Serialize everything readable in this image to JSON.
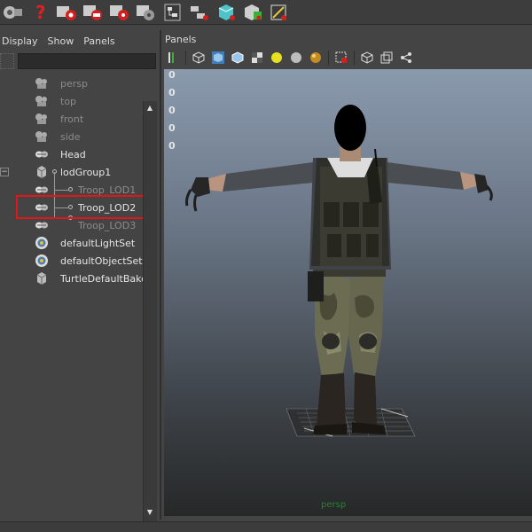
{
  "shelf": {
    "icons": [
      "render-camera-icon",
      "help-icon",
      "render-settings-icon",
      "ipr-render-icon",
      "render-view-icon",
      "render-globals-icon",
      "hypershade-icon",
      "sep",
      "connection-editor-icon",
      "attribute-spreadsheet-icon",
      "cube-select-icon",
      "layer-editor-icon"
    ]
  },
  "outliner": {
    "menu": {
      "display": "Display",
      "show": "Show",
      "panels": "Panels"
    },
    "search_value": "",
    "items": [
      {
        "label": "persp",
        "state": "dim"
      },
      {
        "label": "top",
        "state": "dim"
      },
      {
        "label": "front",
        "state": "dim"
      },
      {
        "label": "side",
        "state": "dim"
      },
      {
        "label": "Head",
        "state": "bright"
      },
      {
        "label": "lodGroup1",
        "state": "bright"
      },
      {
        "label": "Troop_LOD1",
        "state": "dim"
      },
      {
        "label": "Troop_LOD2",
        "state": "bright"
      },
      {
        "label": "Troop_LOD3",
        "state": "dim"
      },
      {
        "label": "defaultLightSet",
        "state": "bright"
      },
      {
        "label": "defaultObjectSet",
        "state": "bright"
      },
      {
        "label": "TurtleDefaultBakeLa",
        "state": "bright"
      }
    ],
    "collapse_glyph": "−",
    "selected_item": "Troop_LOD2"
  },
  "viewport": {
    "menu": {
      "panels": "Panels"
    },
    "hud": [
      "0",
      "0",
      "0",
      "0",
      "0"
    ],
    "camera_label": "persp",
    "subject": "soldier character model in T-pose"
  },
  "colors": {
    "highlight": "#e0161b",
    "camera_label": "#1f8a2c"
  }
}
